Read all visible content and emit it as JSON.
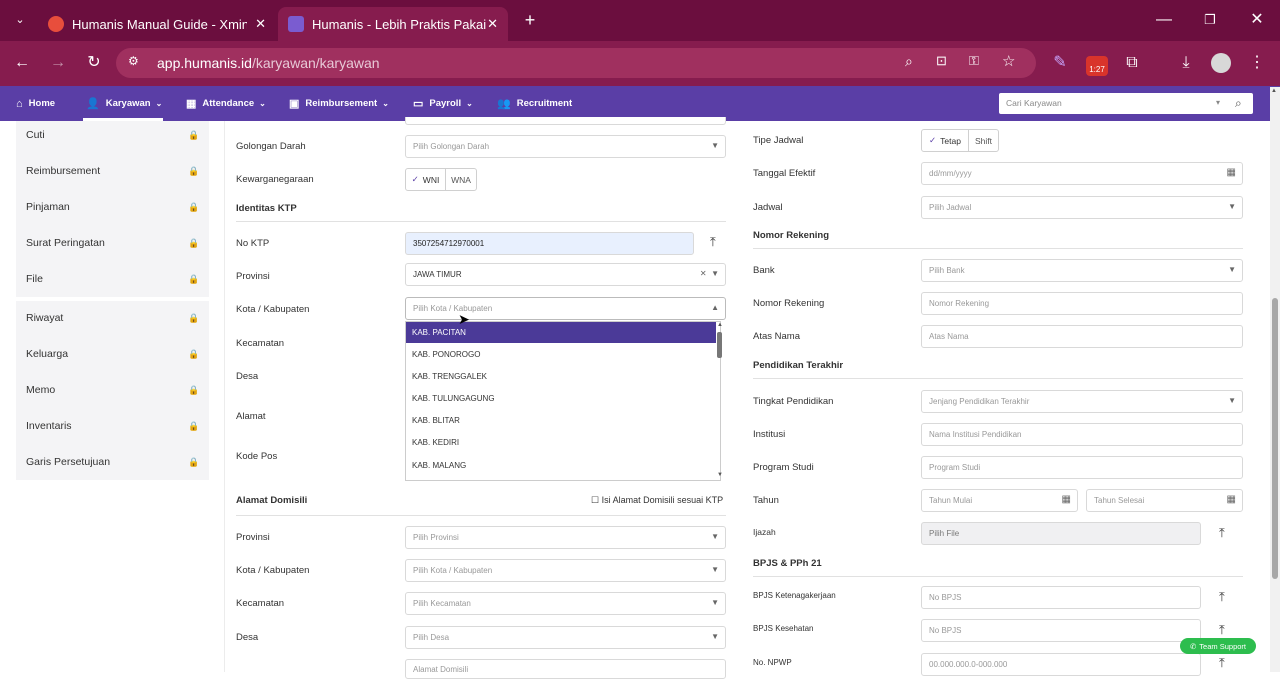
{
  "browser": {
    "tabs": [
      {
        "title": "Humanis Manual Guide - Xmind"
      },
      {
        "title": "Humanis - Lebih Praktis Pakai Humanis"
      }
    ],
    "url_domain": "app.humanis.id",
    "url_path": "/karyawan/karyawan",
    "badge": "1:27"
  },
  "nav": {
    "items": [
      "Home",
      "Karyawan",
      "Attendance",
      "Reimbursement",
      "Payroll",
      "Recruitment"
    ],
    "search_placeholder": "Cari Karyawan"
  },
  "sidebar": {
    "group1": [
      "Cuti",
      "Reimbursement",
      "Pinjaman",
      "Surat Peringatan",
      "File"
    ],
    "group2": [
      "Riwayat",
      "Keluarga",
      "Memo",
      "Inventaris",
      "Garis Persetujuan"
    ]
  },
  "left": {
    "golongan_label": "Golongan Darah",
    "golongan_ph": "Pilih Golongan Darah",
    "kewarga_label": "Kewarganegaraan",
    "wni": "WNI",
    "wna": "WNA",
    "ktp_section": "Identitas KTP",
    "noktp_label": "No KTP",
    "noktp_value": "3507254712970001",
    "prov_label": "Provinsi",
    "prov_value": "JAWA TIMUR",
    "kota_label": "Kota / Kabupaten",
    "kota_ph": "Pilih Kota / Kabupaten",
    "kec_label": "Kecamatan",
    "desa_label": "Desa",
    "alamat_label": "Alamat",
    "kodepos_label": "Kode Pos",
    "dropdown": [
      "KAB. PACITAN",
      "KAB. PONOROGO",
      "KAB. TRENGGALEK",
      "KAB. TULUNGAGUNG",
      "KAB. BLITAR",
      "KAB. KEDIRI",
      "KAB. MALANG"
    ],
    "dom_section": "Alamat Domisili",
    "dom_check": "Isi Alamat Domisili sesuai KTP",
    "dom_prov_label": "Provinsi",
    "dom_prov_ph": "Pilih Provinsi",
    "dom_kota_label": "Kota / Kabupaten",
    "dom_kota_ph": "Pilih Kota / Kabupaten",
    "dom_kec_label": "Kecamatan",
    "dom_kec_ph": "Pilih Kecamatan",
    "dom_desa_label": "Desa",
    "dom_desa_ph": "Pilih Desa",
    "dom_alamat_ph": "Alamat Domisili"
  },
  "right": {
    "tipe_label": "Tipe Jadwal",
    "tetap": "Tetap",
    "shift": "Shift",
    "tgl_label": "Tanggal Efektif",
    "tgl_ph": "dd/mm/yyyy",
    "jadwal_label": "Jadwal",
    "jadwal_ph": "Pilih Jadwal",
    "rek_section": "Nomor Rekening",
    "bank_label": "Bank",
    "bank_ph": "Pilih Bank",
    "norek_label": "Nomor Rekening",
    "norek_ph": "Nomor Rekening",
    "atas_label": "Atas Nama",
    "atas_ph": "Atas Nama",
    "pend_section": "Pendidikan Terakhir",
    "tingkat_label": "Tingkat Pendidikan",
    "tingkat_ph": "Jenjang Pendidikan Terakhir",
    "inst_label": "Institusi",
    "inst_ph": "Nama Institusi Pendidikan",
    "prodi_label": "Program Studi",
    "prodi_ph": "Program Studi",
    "tahun_label": "Tahun",
    "tahun_mulai": "Tahun Mulai",
    "tahun_selesai": "Tahun Selesai",
    "ijazah_label": "Ijazah",
    "ijazah_ph": "Pilih File",
    "bpjs_section": "BPJS & PPh 21",
    "bpjstk_label": "BPJS Ketenagakerjaan",
    "bpjstk_ph": "No BPJS",
    "bpjsk_label": "BPJS Kesehatan",
    "bpjsk_ph": "No BPJS",
    "npwp_label": "No. NPWP",
    "npwp_ph": "00.000.000.0-000.000"
  },
  "support": "Team Support"
}
